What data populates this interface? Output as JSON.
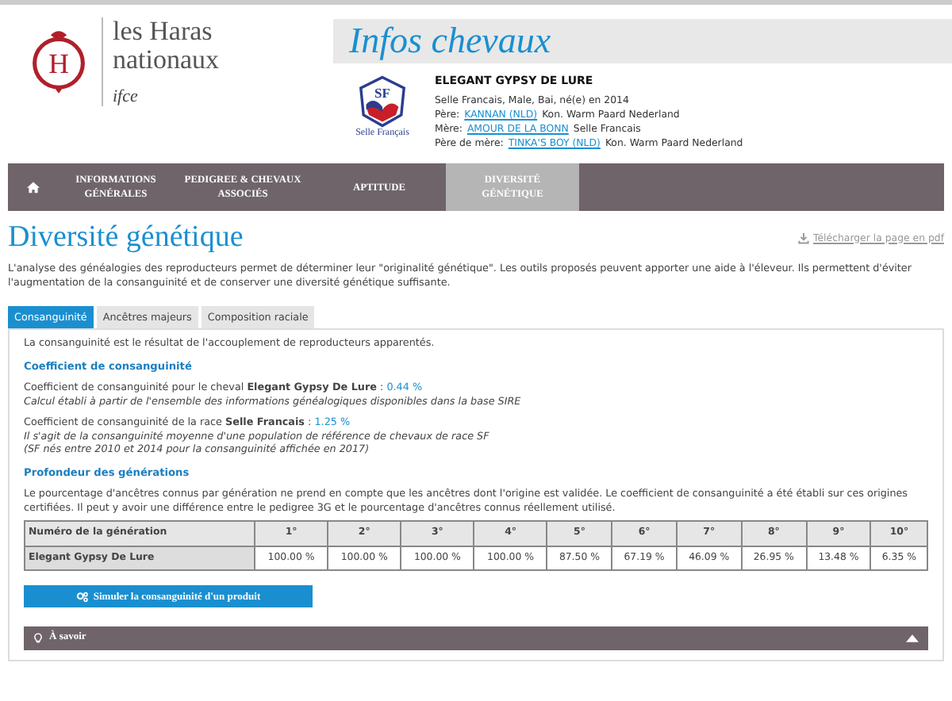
{
  "logo": {
    "line1": "les Haras",
    "line2": "nationaux",
    "brand": "ifce",
    "emblem_letter": "H"
  },
  "header": {
    "title": "Infos chevaux"
  },
  "horse": {
    "breed_logo_letters": "SF",
    "breed_logo_caption": "Selle Français",
    "name": "ELEGANT GYPSY DE LURE",
    "summary": "Selle Francais, Male, Bai, né(e) en 2014",
    "parents": [
      {
        "label": "Père:",
        "link": "KANNAN (NLD)",
        "rest": "Kon. Warm Paard Nederland"
      },
      {
        "label": "Mère:",
        "link": "AMOUR DE LA BONN",
        "rest": "Selle Francais"
      },
      {
        "label": "Père de mère:",
        "link": "TINKA'S BOY (NLD)",
        "rest": "Kon. Warm Paard Nederland"
      }
    ]
  },
  "nav": [
    {
      "label": "INFORMATIONS GÉNÉRALES",
      "selected": false
    },
    {
      "label": "PEDIGREE & CHEVAUX ASSOCIÉS",
      "selected": false
    },
    {
      "label": "APTITUDE",
      "selected": false
    },
    {
      "label": "DIVERSITÉ GÉNÉTIQUE",
      "selected": true
    }
  ],
  "page": {
    "title": "Diversité génétique",
    "download": "Télécharger la page en pdf",
    "intro": "L'analyse des généalogies des reproducteurs permet de déterminer leur \"originalité génétique\". Les outils proposés peuvent apporter une aide à l'éleveur. Ils permettent d'éviter l'augmentation de la consanguinité et de conserver une diversité génétique suffisante."
  },
  "tabs": [
    {
      "label": "Consanguinité",
      "selected": true
    },
    {
      "label": "Ancêtres majeurs",
      "selected": false
    },
    {
      "label": "Composition raciale",
      "selected": false
    }
  ],
  "panel": {
    "intro": "La consanguinité est le résultat de l'accouplement de reproducteurs apparentés.",
    "section1": "Coefficient de consanguinité",
    "coefficients": [
      {
        "text": "Coefficient de consanguinité pour le cheval **Elegant Gypsy De Lure** :",
        "value": "0.44 %",
        "notes": [
          "Calcul établi à partir de l'ensemble des informations généalogiques disponibles dans la base SIRE"
        ]
      },
      {
        "text": "Coefficient de consanguinité de la race **Selle Francais** :",
        "value": "1.25 %",
        "notes": [
          "Il s'agit de la consanguinité moyenne d'une population de référence de chevaux de race SF",
          "(SF nés entre 2010 et 2014 pour la consanguinité affichée en 2017)"
        ]
      }
    ],
    "section2": "Profondeur des générations",
    "depth_text": "Le pourcentage d'ancêtres connus par génération ne prend en compte que les ancêtres dont l'origine est validée. Le coefficient de consanguinité a été établi sur ces origines certifiées. Il peut y avoir une différence entre le pedigree 3G et le pourcentage d'ancêtres connus réellement utilisé.",
    "table": {
      "columns": [
        "Numéro de la génération",
        "1°",
        "2°",
        "3°",
        "4°",
        "5°",
        "6°",
        "7°",
        "8°",
        "9°",
        "10°"
      ],
      "rows": [
        [
          "Elegant Gypsy De Lure",
          "100.00 %",
          "100.00 %",
          "100.00 %",
          "100.00 %",
          "87.50 %",
          "67.19 %",
          "46.09 %",
          "26.95 %",
          "13.48 %",
          "6.35 %"
        ]
      ]
    },
    "simulate_button": "Simuler la consanguinité d'un produit",
    "accordion": {
      "label": "À savoir",
      "expanded": true
    }
  }
}
